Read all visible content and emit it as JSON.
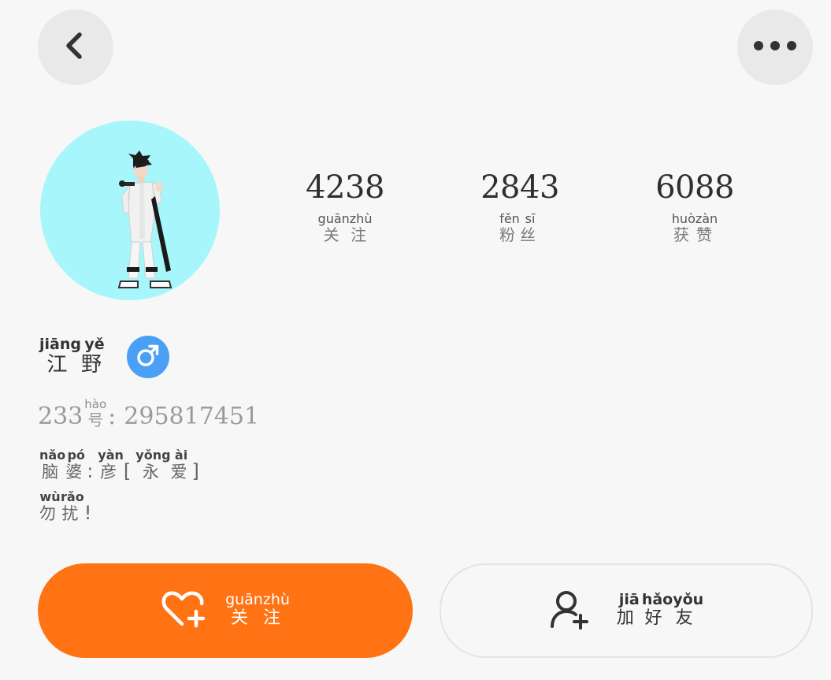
{
  "header": {
    "back_icon": "chevron-left-icon",
    "more_icon": "more-horizontal-icon"
  },
  "profile": {
    "avatar_bg": "#a6f6fb",
    "name": {
      "chars": [
        {
          "hanzi": "江",
          "pinyin": "jiāng"
        },
        {
          "hanzi": "野",
          "pinyin": "yě"
        }
      ]
    },
    "gender": {
      "symbol": "♂",
      "color": "#4aa0f5"
    },
    "id_line": {
      "prefix": "233",
      "hao": {
        "hanzi": "号",
        "pinyin": "hào"
      },
      "separator": ":",
      "value": "295817451"
    },
    "bio": {
      "line1": [
        {
          "hanzi": "脑",
          "pinyin": "nǎo"
        },
        {
          "hanzi": "婆",
          "pinyin": "pó"
        },
        {
          "punct": ":"
        },
        {
          "hanzi": "彦",
          "pinyin": "yàn"
        },
        {
          "punct": "["
        },
        {
          "hanzi": "永",
          "pinyin": "yǒng"
        },
        {
          "hanzi": "爱",
          "pinyin": "ài"
        },
        {
          "punct": "]"
        }
      ],
      "line2": [
        {
          "hanzi": "勿",
          "pinyin": "wù"
        },
        {
          "hanzi": "扰",
          "pinyin": "rǎo"
        },
        {
          "punct": "!"
        }
      ]
    }
  },
  "stats": [
    {
      "value": "4238",
      "label": [
        {
          "hanzi": "关",
          "pinyin": "guān"
        },
        {
          "hanzi": "注",
          "pinyin": "zhù"
        }
      ]
    },
    {
      "value": "2843",
      "label": [
        {
          "hanzi": "粉",
          "pinyin": "fěn"
        },
        {
          "hanzi": "丝",
          "pinyin": "sī"
        }
      ]
    },
    {
      "value": "6088",
      "label": [
        {
          "hanzi": "获",
          "pinyin": "huò"
        },
        {
          "hanzi": "赞",
          "pinyin": "zàn"
        }
      ]
    }
  ],
  "actions": {
    "follow": {
      "icon": "heart-plus-icon",
      "bg": "#ff7315",
      "label": [
        {
          "hanzi": "关",
          "pinyin": "guān"
        },
        {
          "hanzi": "注",
          "pinyin": "zhù"
        }
      ]
    },
    "add_friend": {
      "icon": "user-plus-icon",
      "label": [
        {
          "hanzi": "加",
          "pinyin": "jiā"
        },
        {
          "hanzi": "好",
          "pinyin": "hǎo"
        },
        {
          "hanzi": "友",
          "pinyin": "yǒu"
        }
      ]
    }
  }
}
